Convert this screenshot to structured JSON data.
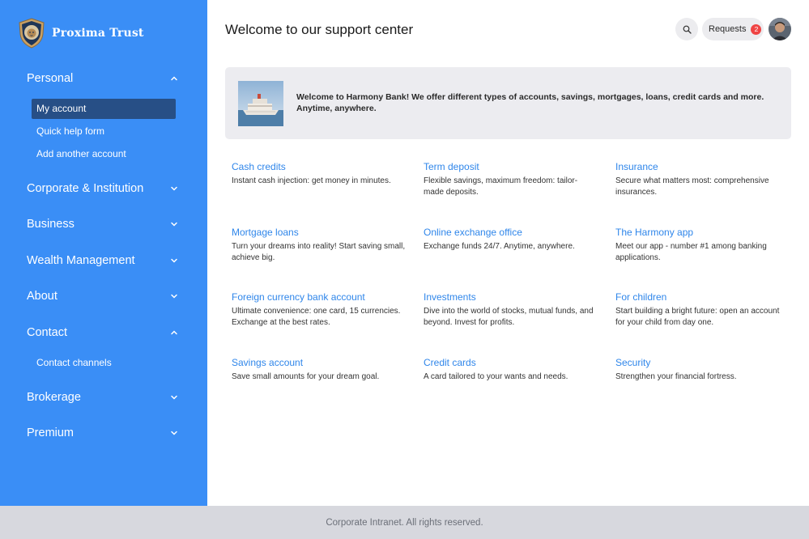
{
  "brand": {
    "name": "Proxima Trust"
  },
  "sidebar": {
    "sections": [
      {
        "label": "Personal",
        "expanded": true,
        "items": [
          {
            "label": "My account",
            "active": true
          },
          {
            "label": "Quick help form"
          },
          {
            "label": "Add another account"
          }
        ]
      },
      {
        "label": "Corporate & Institution",
        "expanded": false
      },
      {
        "label": "Business",
        "expanded": false
      },
      {
        "label": "Wealth Management",
        "expanded": false
      },
      {
        "label": "About",
        "expanded": false
      },
      {
        "label": "Contact",
        "expanded": true,
        "items": [
          {
            "label": "Contact channels"
          }
        ]
      },
      {
        "label": "Brokerage",
        "expanded": false
      },
      {
        "label": "Premium",
        "expanded": false
      }
    ]
  },
  "header": {
    "title": "Welcome to our support center",
    "search_icon": "search-icon",
    "requests_label": "Requests",
    "requests_count": "2"
  },
  "banner": {
    "text": "Welcome to Harmony Bank! We offer different types of accounts, savings, mortgages, loans, credit cards and more. Anytime, anywhere."
  },
  "services": [
    {
      "title": "Cash credits",
      "desc": "Instant cash injection: get money in minutes."
    },
    {
      "title": "Term deposit",
      "desc": "Flexible savings, maximum freedom: tailor-made deposits."
    },
    {
      "title": "Insurance",
      "desc": "Secure what matters most: comprehensive insurances."
    },
    {
      "title": "Mortgage loans",
      "desc": "Turn your dreams into reality! Start saving small, achieve big."
    },
    {
      "title": "Online exchange office",
      "desc": "Exchange funds 24/7. Anytime, anywhere."
    },
    {
      "title": "The Harmony app",
      "desc": "Meet our app - number #1 among banking applications."
    },
    {
      "title": "Foreign currency bank account",
      "desc": "Ultimate convenience: one card, 15 currencies. Exchange at the best rates."
    },
    {
      "title": "Investments",
      "desc": "Dive into the world of stocks, mutual funds, and beyond. Invest for profits."
    },
    {
      "title": "For children",
      "desc": "Start building a bright future: open an account for your child from day one."
    },
    {
      "title": "Savings account",
      "desc": "Save small amounts for your dream goal."
    },
    {
      "title": "Credit cards",
      "desc": "A card tailored to your wants and needs."
    },
    {
      "title": "Security",
      "desc": "Strengthen your financial fortress."
    }
  ],
  "footer": {
    "text": "Corporate Intranet. All rights reserved."
  },
  "colors": {
    "sidebar_bg": "#3a8ef6",
    "active_item_bg": "#274f86",
    "link": "#2f86ea",
    "badge": "#ef4444",
    "footer_bg": "#d7d8de"
  }
}
